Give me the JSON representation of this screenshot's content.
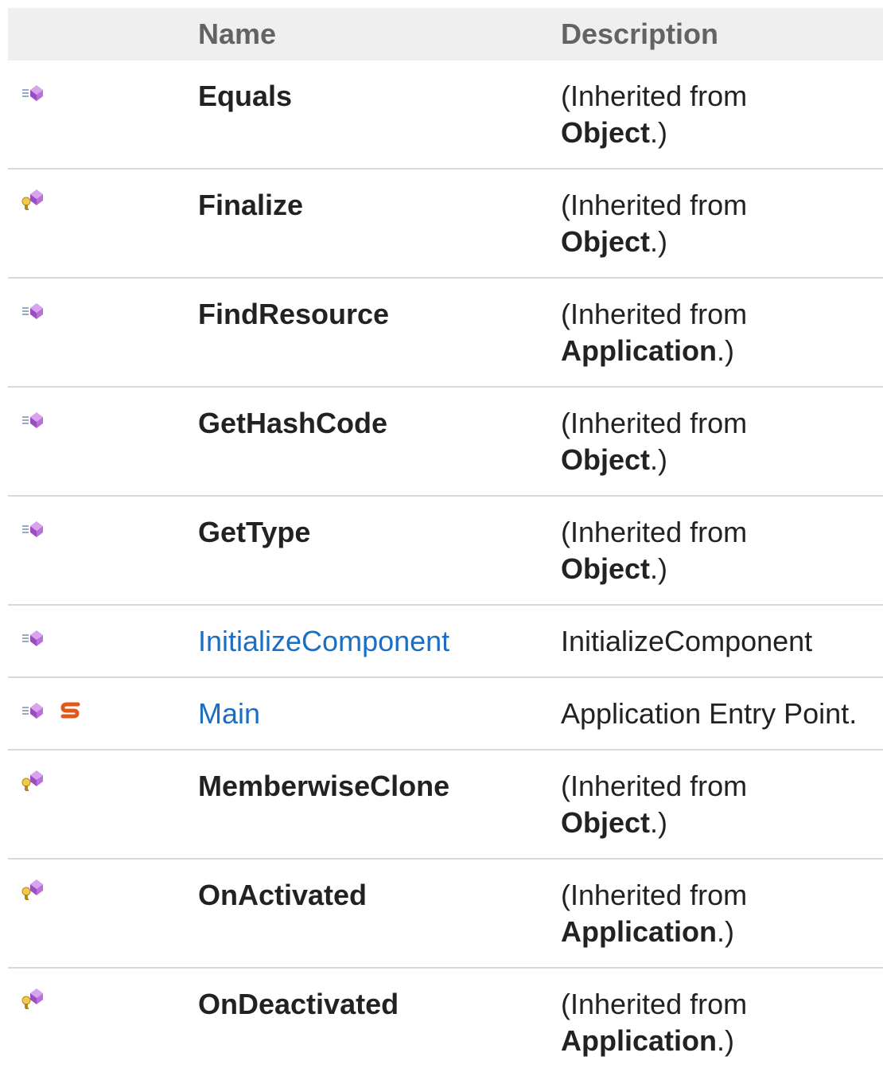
{
  "headers": {
    "icon": "",
    "name": "Name",
    "description": "Description"
  },
  "rows": [
    {
      "icon": "public-method-icon",
      "name": "Equals",
      "link": false,
      "desc_prefix": "(Inherited from",
      "desc_ref": "Object",
      "desc_suffix": ".)"
    },
    {
      "icon": "protected-method-icon",
      "name": "Finalize",
      "link": false,
      "desc_prefix": "(Inherited from",
      "desc_ref": "Object",
      "desc_suffix": ".)"
    },
    {
      "icon": "public-method-icon",
      "name": "FindResource",
      "link": false,
      "desc_prefix": "(Inherited from",
      "desc_ref": "Application",
      "desc_suffix": ".)"
    },
    {
      "icon": "public-method-icon",
      "name": "GetHashCode",
      "link": false,
      "desc_prefix": "(Inherited from",
      "desc_ref": "Object",
      "desc_suffix": ".)"
    },
    {
      "icon": "public-method-icon",
      "name": "GetType",
      "link": false,
      "desc_prefix": "(Inherited from",
      "desc_ref": "Object",
      "desc_suffix": ".)"
    },
    {
      "icon": "public-method-icon",
      "name": "InitializeComponent",
      "link": true,
      "desc": "InitializeComponent"
    },
    {
      "icon": "public-static-method-icon",
      "name": "Main",
      "link": true,
      "desc": "Application Entry Point."
    },
    {
      "icon": "protected-method-icon",
      "name": "MemberwiseClone",
      "link": false,
      "desc_prefix": "(Inherited from",
      "desc_ref": "Object",
      "desc_suffix": ".)"
    },
    {
      "icon": "protected-method-icon",
      "name": "OnActivated",
      "link": false,
      "desc_prefix": "(Inherited from",
      "desc_ref": "Application",
      "desc_suffix": ".)"
    },
    {
      "icon": "protected-method-icon",
      "name": "OnDeactivated",
      "link": false,
      "desc_prefix": "(Inherited from",
      "desc_ref": "Application",
      "desc_suffix": ".)"
    }
  ]
}
